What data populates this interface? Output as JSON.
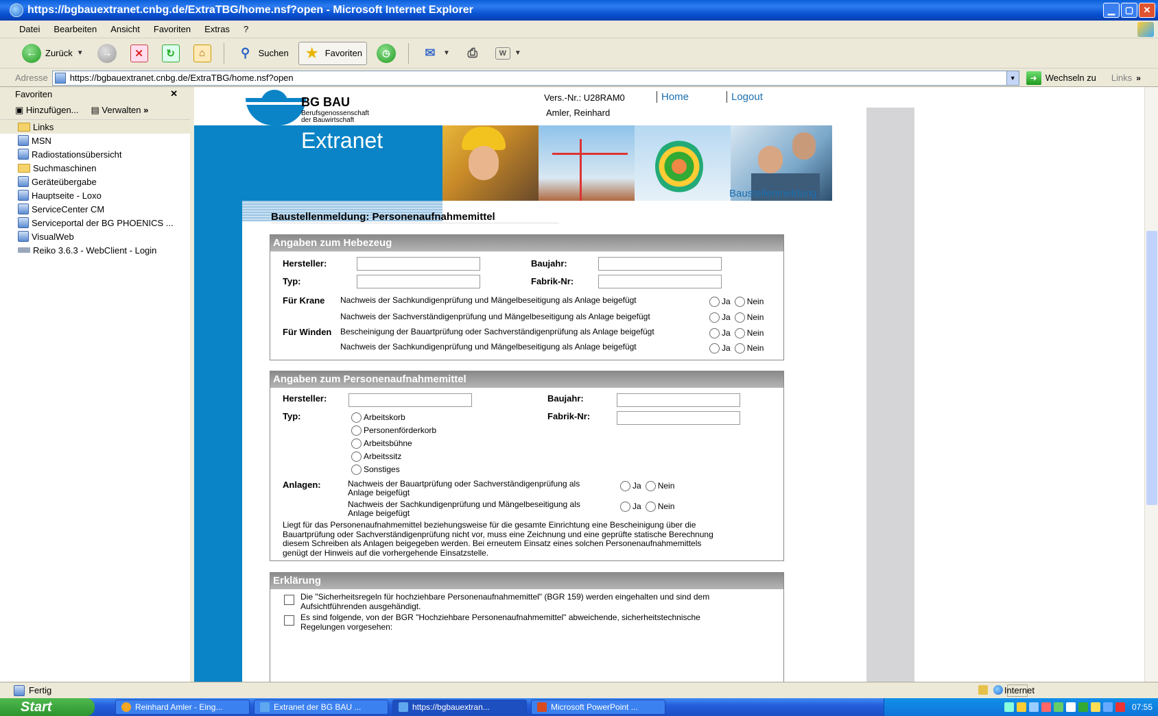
{
  "window": {
    "title": "https://bgbauextranet.cnbg.de/ExtraTBG/home.nsf?open - Microsoft Internet Explorer"
  },
  "menu": [
    "Datei",
    "Bearbeiten",
    "Ansicht",
    "Favoriten",
    "Extras",
    "?"
  ],
  "toolbar": {
    "back": "Zurück",
    "search": "Suchen",
    "favorites": "Favoriten"
  },
  "address": {
    "label": "Adresse",
    "url": "https://bgbauextranet.cnbg.de/ExtraTBG/home.nsf?open",
    "go": "Wechseln zu",
    "links": "Links"
  },
  "favorites": {
    "title": "Favoriten",
    "add": "Hinzufügen...",
    "manage": "Verwalten",
    "items": [
      {
        "label": "Links",
        "icon": "folder-icon"
      },
      {
        "label": "MSN",
        "icon": "page-icon"
      },
      {
        "label": "Radiostationsübersicht",
        "icon": "page-icon"
      },
      {
        "label": "Suchmaschinen",
        "icon": "folder-icon"
      },
      {
        "label": "Geräteübergabe",
        "icon": "page-icon"
      },
      {
        "label": "Hauptseite - Loxo",
        "icon": "page-icon"
      },
      {
        "label": "ServiceCenter CM",
        "icon": "page-icon"
      },
      {
        "label": "Serviceportal der BG PHOENICS ...",
        "icon": "page-icon"
      },
      {
        "label": "VisualWeb",
        "icon": "page-icon"
      },
      {
        "label": "Reiko 3.6.3 - WebClient - Login",
        "icon": "small-icon"
      }
    ]
  },
  "site": {
    "brand": "BG BAU",
    "brand_sub1": "Berufsgenossenschaft",
    "brand_sub2": "der Bauwirtschaft",
    "version": "Vers.-Nr.: U28RAM0",
    "user": "Amler, Reinhard",
    "home": "Home",
    "logout": "Logout",
    "extranet": "Extranet",
    "breadcrumb": "Baustellenmeldung",
    "page_title": "Baustellenmeldung: Personenaufnahmemittel"
  },
  "hebezeug": {
    "heading": "Angaben zum Hebezeug",
    "hersteller": "Hersteller:",
    "baujahr": "Baujahr:",
    "typ": "Typ:",
    "fabrik": "Fabrik-Nr:",
    "fuer_krane": "Für Krane",
    "fuer_winden": "Für Winden",
    "rows": [
      "Nachweis der Sachkundigenprüfung und Mängelbeseitigung als Anlage beigefügt",
      "Nachweis der Sachverständigenprüfung und Mängelbeseitigung als Anlage beigefügt",
      "Bescheinigung der Bauartprüfung oder Sachverständigenprüfung als Anlage beigefügt",
      "Nachweis der Sachkundigenprüfung und Mängelbeseitigung als Anlage beigefügt"
    ],
    "ja": "Ja",
    "nein": "Nein"
  },
  "pam": {
    "heading": "Angaben zum Personenaufnahmemittel",
    "hersteller": "Hersteller:",
    "baujahr": "Baujahr:",
    "typ": "Typ:",
    "fabrik": "Fabrik-Nr:",
    "types": [
      "Arbeitskorb",
      "Personenförderkorb",
      "Arbeitsbühne",
      "Arbeitssitz",
      "Sonstiges"
    ],
    "anlagen": "Anlagen:",
    "anlage1a": "Nachweis der Bauartprüfung oder Sachverständigenprüfung als",
    "anlage1b": "Anlage beigefügt",
    "anlage2a": "Nachweis der Sachkundigenprüfung und Mängelbeseitigung als",
    "anlage2b": "Anlage beigefügt",
    "note1": "Liegt für das Personenaufnahmemittel beziehungsweise für die gesamte Einrichtung eine Bescheinigung über die",
    "note2": "Bauartprüfung oder Sachverständigenprüfung nicht vor, muss eine Zeichnung und eine geprüfte statische Berechnung",
    "note3": "diesem Schreiben als Anlagen beigegeben werden. Bei erneutem Einsatz eines solchen Personenaufnahmemittels",
    "note4": "genügt der Hinweis auf die vorhergehende Einsatzstelle.",
    "ja": "Ja",
    "nein": "Nein"
  },
  "erklaerung": {
    "heading": "Erklärung",
    "c1a": "Die \"Sicherheitsregeln für hochziehbare Personenaufnahmemittel\" (BGR 159) werden eingehalten und sind dem",
    "c1b": "Aufsichtführenden ausgehändigt.",
    "c2a": "Es sind folgende, von der BGR \"Hochziehbare Personenaufnahmemittel\" abweichende, sicherheitstechnische",
    "c2b": "Regelungen vorgesehen:"
  },
  "status": {
    "left": "Fertig",
    "zone": "Internet"
  },
  "taskbar": {
    "start": "Start",
    "tasks": [
      "Reinhard Amler - Eing...",
      "Extranet der BG BAU ...",
      "https://bgbauextran...",
      "Microsoft PowerPoint ..."
    ],
    "clock": "07:55"
  }
}
